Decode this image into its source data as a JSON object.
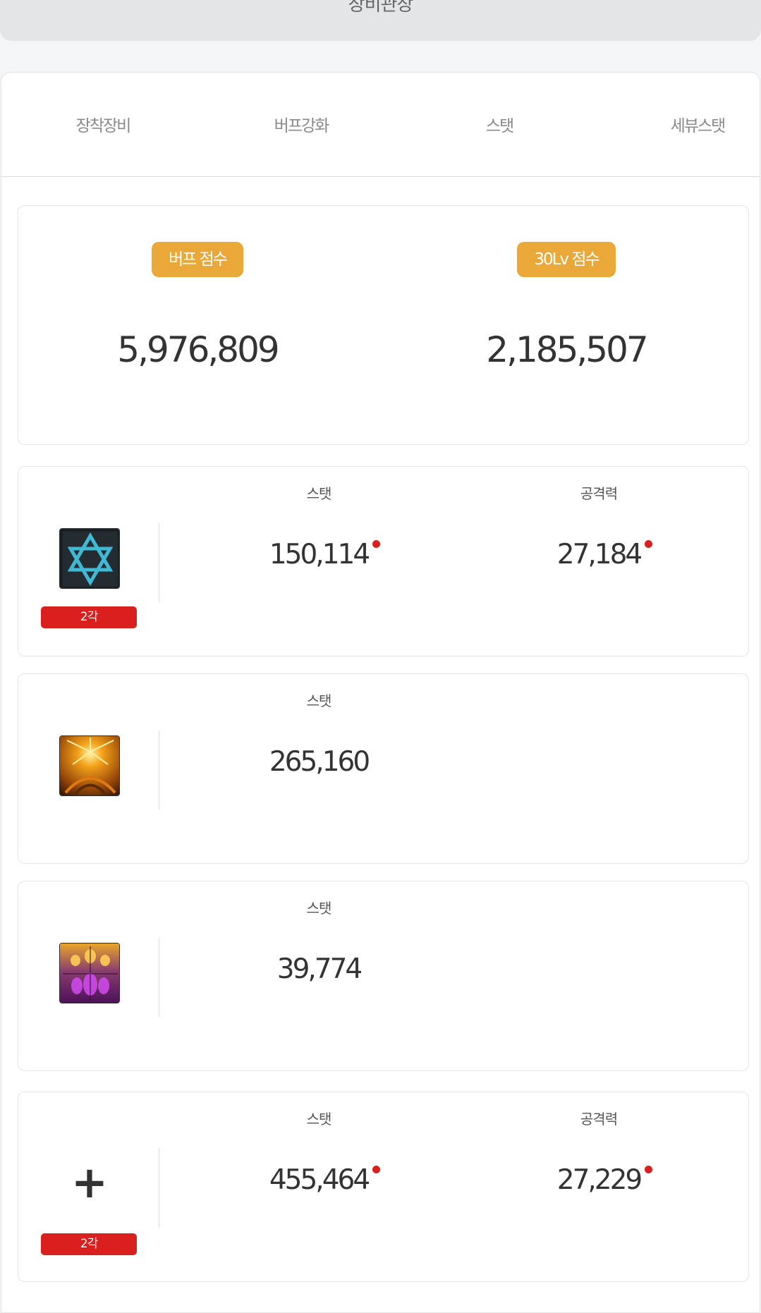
{
  "header": {
    "title": "장비관장"
  },
  "tabs": [
    "장착장비",
    "버프강화",
    "스탯",
    "세뷰스탯"
  ],
  "scores": [
    {
      "label": "버프 점수",
      "value": "5,976,809"
    },
    {
      "label": "30Lv 점수",
      "value": "2,185,507"
    }
  ],
  "items": [
    {
      "icon": "hexagram-icon",
      "badge": "2각",
      "stat_label": "스탯",
      "stat_value": "150,114",
      "stat_changed": true,
      "attack_label": "공격력",
      "attack_value": "27,184",
      "attack_changed": true
    },
    {
      "icon": "golden-burst-icon",
      "stat_label": "스탯",
      "stat_value": "265,160"
    },
    {
      "icon": "purple-ornament-icon",
      "stat_label": "스탯",
      "stat_value": "39,774"
    },
    {
      "icon": "plus-icon",
      "badge": "2각",
      "stat_label": "스탯",
      "stat_value": "455,464",
      "stat_changed": true,
      "attack_label": "공격력",
      "attack_value": "27,229",
      "attack_changed": true
    }
  ],
  "colors": {
    "score_badge": "#e9a837",
    "level_badge": "#d9201e",
    "changed_dot": "#d9201e"
  }
}
